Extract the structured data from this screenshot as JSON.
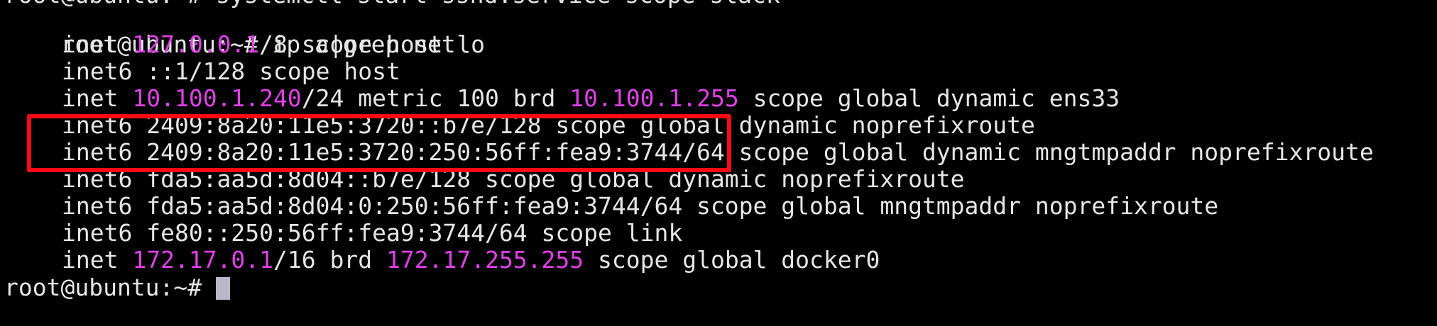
{
  "terminal": {
    "clipped_top_text": "root@ubuntu:~# systemctl start sshd.service scope slack",
    "prompt_command": "root@ubuntu:~# ip a|grep net",
    "lines": [
      {
        "kw": "inet",
        "addr": "127.0.0.1",
        "rest": "/8 scope host lo"
      },
      {
        "kw": "inet6",
        "addr": "",
        "rest": " ::1/128 scope host"
      },
      {
        "kw": "inet",
        "addr": "10.100.1.240",
        "rest_a": "/24 metric 100 brd ",
        "addr2": "10.100.1.255",
        "rest_b": " scope global dynamic ens33"
      },
      {
        "kw": "inet6",
        "rest": " 2409:8a20:11e5:3720::b7e/128 scope global dynamic noprefixroute"
      },
      {
        "kw": "inet6",
        "rest": " 2409:8a20:11e5:3720:250:56ff:fea9:3744/64 scope global dynamic mngtmpaddr noprefixroute"
      },
      {
        "kw": "inet6",
        "rest": " fda5:aa5d:8d04::b7e/128 scope global dynamic noprefixroute"
      },
      {
        "kw": "inet6",
        "rest": " fda5:aa5d:8d04:0:250:56ff:fea9:3744/64 scope global mngtmpaddr noprefixroute"
      },
      {
        "kw": "inet6",
        "rest": " fe80::250:56ff:fea9:3744/64 scope link"
      },
      {
        "kw": "inet",
        "addr": "172.17.0.1",
        "rest_a": "/16 brd ",
        "addr2": "172.17.255.255",
        "rest_b": " scope global docker0"
      }
    ],
    "prompt_final": "root@ubuntu:~# "
  },
  "colors": {
    "background": "#000000",
    "text": "#e6e6e6",
    "ip_highlight": "#e040e8",
    "annotation_box": "#ff0a14",
    "cursor": "#b8b8c8"
  }
}
